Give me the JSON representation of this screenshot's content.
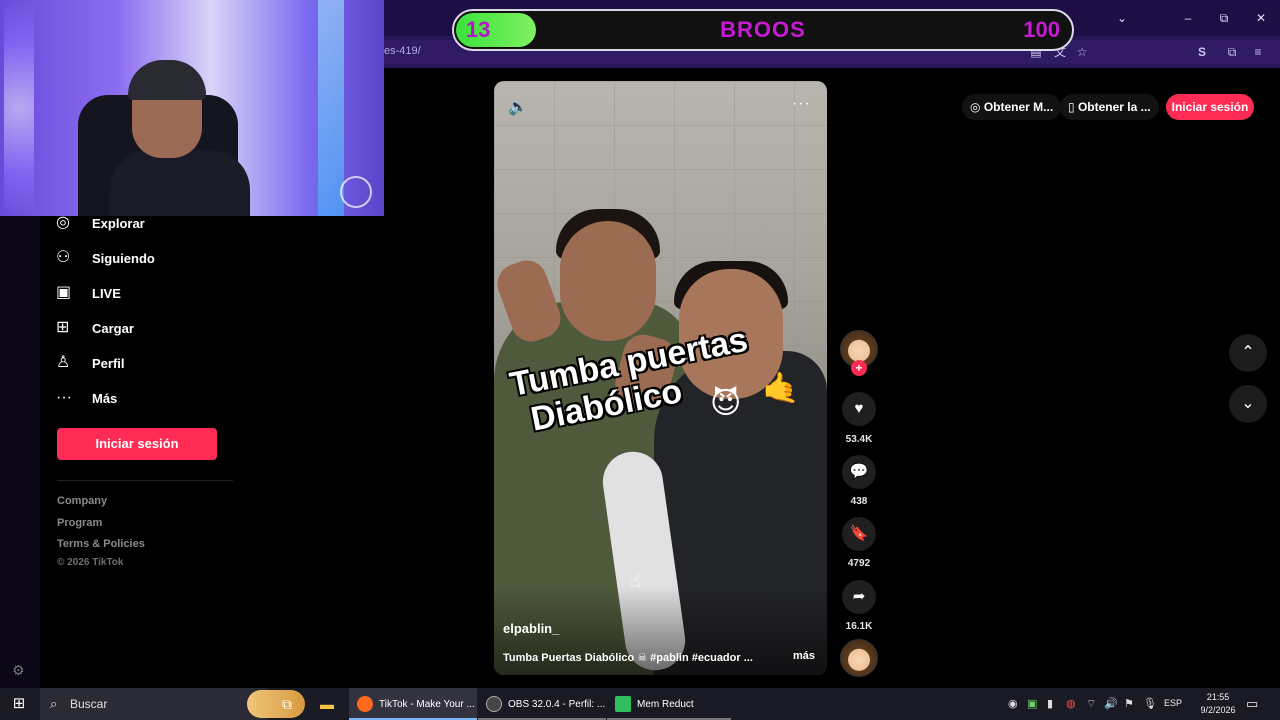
{
  "browser": {
    "url_fragment": "es-419/",
    "window_controls": {
      "minimize": "–",
      "maximize": "⧉",
      "close": "✕"
    }
  },
  "overlay": {
    "left_score": "13",
    "title": "BROOS",
    "right_score": "100",
    "progress_fraction": 0.13
  },
  "sidebar": {
    "items": [
      {
        "label": "Explorar",
        "icon": "compass-icon"
      },
      {
        "label": "Siguiendo",
        "icon": "following-icon"
      },
      {
        "label": "LIVE",
        "icon": "live-tv-icon"
      },
      {
        "label": "Cargar",
        "icon": "upload-icon"
      },
      {
        "label": "Perfil",
        "icon": "profile-icon"
      },
      {
        "label": "Más",
        "icon": "more-dots-icon"
      }
    ],
    "login_label": "Iniciar sesión",
    "footer_links": [
      "Company",
      "Program",
      "Terms & Policies"
    ],
    "copyright": "© 2026 TikTok"
  },
  "video": {
    "overlay_line1": "Tumba puertas",
    "overlay_line2": "Diabólico",
    "author": "elpablin_",
    "description": "Tumba Puertas Diabólico ☠ #pablin #ecuador ...",
    "more_label": "más"
  },
  "actions": {
    "likes": "53.4K",
    "comments": "438",
    "saves": "4792",
    "shares": "16.1K"
  },
  "header": {
    "get_coins_label": "Obtener M...",
    "get_app_label": "Obtener la ...",
    "login_label": "Iniciar sesión"
  },
  "taskbar": {
    "search_placeholder": "Buscar",
    "apps": [
      {
        "label": "TikTok - Make Your ...",
        "color": "#ff6a1f"
      },
      {
        "label": "OBS 32.0.4 - Perfil: ...",
        "color": "#444444"
      },
      {
        "label": "Mem Reduct",
        "color": "#2fbf5f"
      }
    ],
    "language": "ESP",
    "time": "21:55",
    "date": "9/2/2026"
  },
  "colors": {
    "accent": "#fe2c55",
    "overlay_green": "#3be33b",
    "overlay_text": "#c61bd3",
    "browser_chrome": "#2a1559"
  }
}
